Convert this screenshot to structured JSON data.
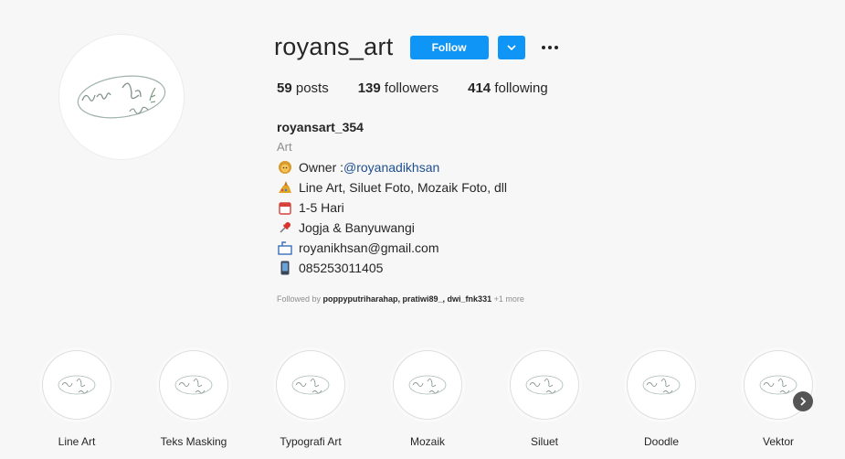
{
  "profile": {
    "username": "royans_art",
    "follow_label": "Follow",
    "stats": {
      "posts_count": "59",
      "posts_label": "posts",
      "followers_count": "139",
      "followers_label": "followers",
      "following_count": "414",
      "following_label": "following"
    },
    "bio": {
      "name": "royansart_354",
      "category": "Art",
      "lines": [
        {
          "icon": "lion-emoji-icon",
          "prefix": "Owner : ",
          "link": "@royanadikhsan"
        },
        {
          "icon": "art-palette-icon",
          "text": "Line Art, Siluet Foto, Mozaik Foto, dll"
        },
        {
          "icon": "calendar-icon",
          "text": "1-5 Hari"
        },
        {
          "icon": "pin-icon",
          "text": "Jogja & Banyuwangi"
        },
        {
          "icon": "mailbox-icon",
          "text": "royanikhsan@gmail.com"
        },
        {
          "icon": "phone-icon",
          "text": "085253011405"
        }
      ]
    },
    "followed_by": {
      "prefix": "Followed by ",
      "names": "poppyputriharahap, pratiwi89_, dwi_fnk331",
      "suffix": " +1 more"
    }
  },
  "highlights": [
    {
      "label": "Line Art"
    },
    {
      "label": "Teks Masking"
    },
    {
      "label": "Typografi Art"
    },
    {
      "label": "Mozaik"
    },
    {
      "label": "Siluet"
    },
    {
      "label": "Doodle"
    },
    {
      "label": "Vektor"
    }
  ],
  "colors": {
    "accent": "#0f95f6",
    "link": "#1d4f8f"
  }
}
